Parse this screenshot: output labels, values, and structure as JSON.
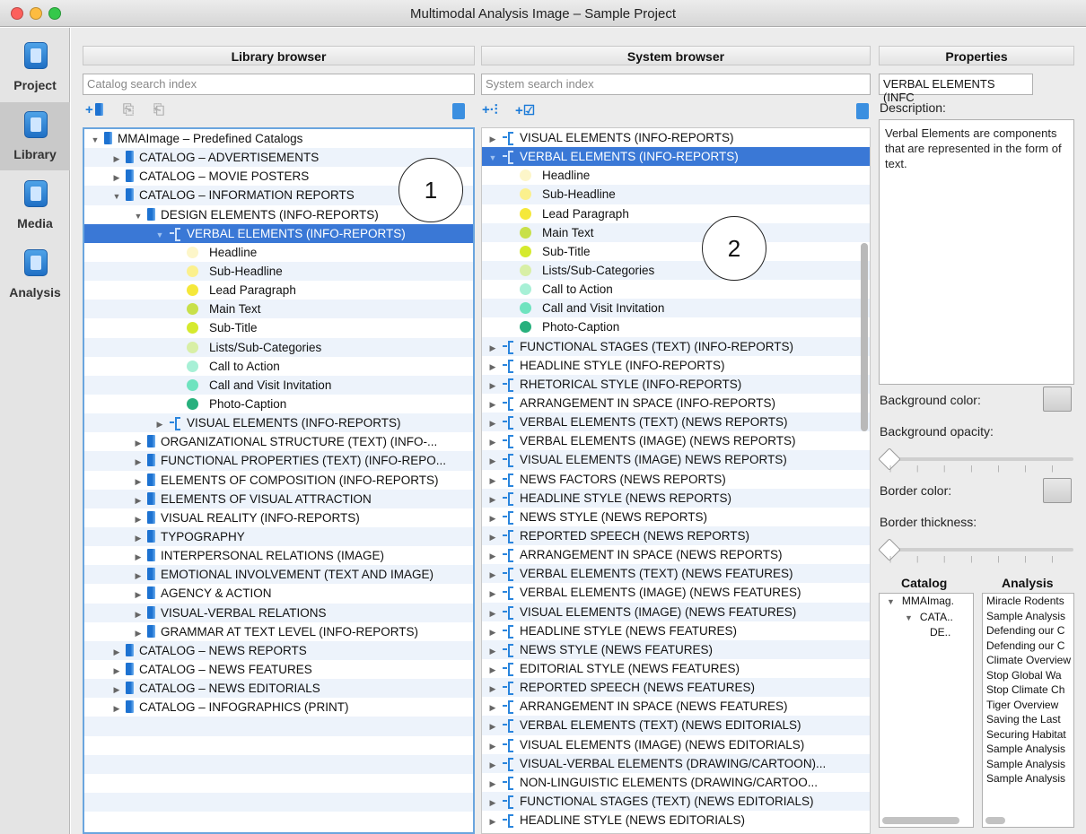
{
  "window": {
    "title": "Multimodal Analysis Image – Sample Project"
  },
  "nav": [
    {
      "label": "Project",
      "icon": "project-icon"
    },
    {
      "label": "Library",
      "icon": "library-icon"
    },
    {
      "label": "Media",
      "icon": "media-icon"
    },
    {
      "label": "Analysis",
      "icon": "analysis-icon"
    }
  ],
  "library": {
    "header": "Library browser",
    "search_placeholder": "Catalog search index",
    "tools": {
      "add": "+",
      "copy": "⎘",
      "paste": "⎗"
    },
    "callout": "1",
    "rows": [
      {
        "text": "MMAImage – Predefined Catalogs",
        "indent": 0,
        "tri": "▼",
        "icon": "book"
      },
      {
        "text": "CATALOG – ADVERTISEMENTS",
        "indent": 1,
        "tri": "▶",
        "icon": "book"
      },
      {
        "text": "CATALOG – MOVIE POSTERS",
        "indent": 1,
        "tri": "▶",
        "icon": "book"
      },
      {
        "text": "CATALOG – INFORMATION REPORTS",
        "indent": 1,
        "tri": "▼",
        "icon": "book"
      },
      {
        "text": "DESIGN ELEMENTS (INFO-REPORTS)",
        "indent": 2,
        "tri": "▼",
        "icon": "book"
      },
      {
        "text": "VERBAL ELEMENTS (INFO-REPORTS)",
        "indent": 3,
        "tri": "▼",
        "icon": "sys",
        "selected": true
      },
      {
        "text": "Headline",
        "indent": 4,
        "dot": "#fdf6c9"
      },
      {
        "text": "Sub-Headline",
        "indent": 4,
        "dot": "#fbf08d"
      },
      {
        "text": "Lead Paragraph",
        "indent": 4,
        "dot": "#f5e83a"
      },
      {
        "text": "Main Text",
        "indent": 4,
        "dot": "#c8e04a"
      },
      {
        "text": "Sub-Title",
        "indent": 4,
        "dot": "#d5ea2e"
      },
      {
        "text": "Lists/Sub-Categories",
        "indent": 4,
        "dot": "#d8efa6"
      },
      {
        "text": "Call to Action",
        "indent": 4,
        "dot": "#a7f0d6"
      },
      {
        "text": "Call and Visit Invitation",
        "indent": 4,
        "dot": "#6fe3bf"
      },
      {
        "text": "Photo-Caption",
        "indent": 4,
        "dot": "#27b07d"
      },
      {
        "text": "VISUAL ELEMENTS (INFO-REPORTS)",
        "indent": 3,
        "tri": "▶",
        "icon": "sys"
      },
      {
        "text": "ORGANIZATIONAL STRUCTURE (TEXT) (INFO-...",
        "indent": 2,
        "tri": "▶",
        "icon": "book"
      },
      {
        "text": "FUNCTIONAL PROPERTIES (TEXT) (INFO-REPO...",
        "indent": 2,
        "tri": "▶",
        "icon": "book"
      },
      {
        "text": "ELEMENTS OF COMPOSITION (INFO-REPORTS)",
        "indent": 2,
        "tri": "▶",
        "icon": "book"
      },
      {
        "text": "ELEMENTS OF VISUAL ATTRACTION",
        "indent": 2,
        "tri": "▶",
        "icon": "book"
      },
      {
        "text": "VISUAL REALITY (INFO-REPORTS)",
        "indent": 2,
        "tri": "▶",
        "icon": "book"
      },
      {
        "text": "TYPOGRAPHY",
        "indent": 2,
        "tri": "▶",
        "icon": "book"
      },
      {
        "text": "INTERPERSONAL RELATIONS (IMAGE)",
        "indent": 2,
        "tri": "▶",
        "icon": "book"
      },
      {
        "text": "EMOTIONAL INVOLVEMENT (TEXT AND IMAGE)",
        "indent": 2,
        "tri": "▶",
        "icon": "book"
      },
      {
        "text": "AGENCY & ACTION",
        "indent": 2,
        "tri": "▶",
        "icon": "book"
      },
      {
        "text": "VISUAL-VERBAL RELATIONS",
        "indent": 2,
        "tri": "▶",
        "icon": "book"
      },
      {
        "text": "GRAMMAR AT TEXT LEVEL (INFO-REPORTS)",
        "indent": 2,
        "tri": "▶",
        "icon": "book"
      },
      {
        "text": "CATALOG – NEWS REPORTS",
        "indent": 1,
        "tri": "▶",
        "icon": "book"
      },
      {
        "text": "CATALOG – NEWS FEATURES",
        "indent": 1,
        "tri": "▶",
        "icon": "book"
      },
      {
        "text": "CATALOG – NEWS EDITORIALS",
        "indent": 1,
        "tri": "▶",
        "icon": "book"
      },
      {
        "text": "CATALOG – INFOGRAPHICS (PRINT)",
        "indent": 1,
        "tri": "▶",
        "icon": "book"
      },
      {
        "text": "",
        "indent": 0
      },
      {
        "text": "",
        "indent": 0
      },
      {
        "text": "",
        "indent": 0
      },
      {
        "text": "",
        "indent": 0
      },
      {
        "text": "",
        "indent": 0
      }
    ]
  },
  "system": {
    "header": "System browser",
    "search_placeholder": "System search index",
    "tools": {
      "add_system": "+·⫶",
      "add_check": "+☑"
    },
    "callout": "2",
    "rows": [
      {
        "text": "VISUAL ELEMENTS (INFO-REPORTS)",
        "indent": 0,
        "tri": "▶",
        "icon": "sys"
      },
      {
        "text": "VERBAL ELEMENTS (INFO-REPORTS)",
        "indent": 0,
        "tri": "▼",
        "icon": "sys",
        "selected": true
      },
      {
        "text": "Headline",
        "indent": 1,
        "dot": "#fdf6c9"
      },
      {
        "text": "Sub-Headline",
        "indent": 1,
        "dot": "#fbf08d"
      },
      {
        "text": "Lead Paragraph",
        "indent": 1,
        "dot": "#f5e83a"
      },
      {
        "text": "Main Text",
        "indent": 1,
        "dot": "#c8e04a"
      },
      {
        "text": "Sub-Title",
        "indent": 1,
        "dot": "#d5ea2e"
      },
      {
        "text": "Lists/Sub-Categories",
        "indent": 1,
        "dot": "#d8efa6"
      },
      {
        "text": "Call to Action",
        "indent": 1,
        "dot": "#a7f0d6"
      },
      {
        "text": "Call and Visit Invitation",
        "indent": 1,
        "dot": "#6fe3bf"
      },
      {
        "text": "Photo-Caption",
        "indent": 1,
        "dot": "#27b07d"
      },
      {
        "text": "FUNCTIONAL STAGES (TEXT) (INFO-REPORTS)",
        "indent": 0,
        "tri": "▶",
        "icon": "sys"
      },
      {
        "text": "HEADLINE STYLE (INFO-REPORTS)",
        "indent": 0,
        "tri": "▶",
        "icon": "sys"
      },
      {
        "text": "RHETORICAL STYLE (INFO-REPORTS)",
        "indent": 0,
        "tri": "▶",
        "icon": "sys"
      },
      {
        "text": "ARRANGEMENT IN SPACE (INFO-REPORTS)",
        "indent": 0,
        "tri": "▶",
        "icon": "sys"
      },
      {
        "text": "VERBAL ELEMENTS (TEXT) (NEWS REPORTS)",
        "indent": 0,
        "tri": "▶",
        "icon": "sys"
      },
      {
        "text": "VERBAL ELEMENTS (IMAGE) (NEWS REPORTS)",
        "indent": 0,
        "tri": "▶",
        "icon": "sys"
      },
      {
        "text": "VISUAL ELEMENTS (IMAGE) NEWS REPORTS)",
        "indent": 0,
        "tri": "▶",
        "icon": "sys"
      },
      {
        "text": "NEWS FACTORS (NEWS REPORTS)",
        "indent": 0,
        "tri": "▶",
        "icon": "sys"
      },
      {
        "text": "HEADLINE STYLE (NEWS REPORTS)",
        "indent": 0,
        "tri": "▶",
        "icon": "sys"
      },
      {
        "text": "NEWS STYLE (NEWS REPORTS)",
        "indent": 0,
        "tri": "▶",
        "icon": "sys"
      },
      {
        "text": "REPORTED SPEECH (NEWS REPORTS)",
        "indent": 0,
        "tri": "▶",
        "icon": "sys"
      },
      {
        "text": "ARRANGEMENT IN SPACE (NEWS REPORTS)",
        "indent": 0,
        "tri": "▶",
        "icon": "sys"
      },
      {
        "text": "VERBAL ELEMENTS (TEXT) (NEWS FEATURES)",
        "indent": 0,
        "tri": "▶",
        "icon": "sys"
      },
      {
        "text": "VERBAL ELEMENTS (IMAGE) (NEWS FEATURES)",
        "indent": 0,
        "tri": "▶",
        "icon": "sys"
      },
      {
        "text": "VISUAL ELEMENTS (IMAGE) (NEWS FEATURES)",
        "indent": 0,
        "tri": "▶",
        "icon": "sys"
      },
      {
        "text": "HEADLINE STYLE (NEWS FEATURES)",
        "indent": 0,
        "tri": "▶",
        "icon": "sys"
      },
      {
        "text": "NEWS STYLE (NEWS FEATURES)",
        "indent": 0,
        "tri": "▶",
        "icon": "sys"
      },
      {
        "text": "EDITORIAL STYLE (NEWS FEATURES)",
        "indent": 0,
        "tri": "▶",
        "icon": "sys"
      },
      {
        "text": "REPORTED SPEECH (NEWS FEATURES)",
        "indent": 0,
        "tri": "▶",
        "icon": "sys"
      },
      {
        "text": "ARRANGEMENT IN SPACE (NEWS FEATURES)",
        "indent": 0,
        "tri": "▶",
        "icon": "sys"
      },
      {
        "text": "VERBAL ELEMENTS (TEXT) (NEWS EDITORIALS)",
        "indent": 0,
        "tri": "▶",
        "icon": "sys"
      },
      {
        "text": "VISUAL ELEMENTS (IMAGE) (NEWS EDITORIALS)",
        "indent": 0,
        "tri": "▶",
        "icon": "sys"
      },
      {
        "text": "VISUAL-VERBAL ELEMENTS (DRAWING/CARTOON)...",
        "indent": 0,
        "tri": "▶",
        "icon": "sys"
      },
      {
        "text": "NON-LINGUISTIC ELEMENTS (DRAWING/CARTOO...",
        "indent": 0,
        "tri": "▶",
        "icon": "sys"
      },
      {
        "text": "FUNCTIONAL STAGES (TEXT) (NEWS EDITORIALS)",
        "indent": 0,
        "tri": "▶",
        "icon": "sys"
      },
      {
        "text": "HEADLINE STYLE (NEWS EDITORIALS)",
        "indent": 0,
        "tri": "▶",
        "icon": "sys"
      }
    ]
  },
  "properties": {
    "header": "Properties",
    "name_value": "VERBAL ELEMENTS (INFC",
    "description_label": "Description:",
    "description_text": "Verbal Elements are components that are represented in the form of text.",
    "background_color_label": "Background color:",
    "background_opacity_label": "Background opacity:",
    "border_color_label": "Border color:",
    "border_thickness_label": "Border thickness:",
    "catalog_header": "Catalog",
    "analysis_header": "Analysis",
    "catalog_rows": [
      {
        "tri": "▼",
        "text": "MMAImag.",
        "indent": 0
      },
      {
        "tri": "▼",
        "text": "CATA..",
        "indent": 1
      },
      {
        "tri": "",
        "text": "DE..",
        "indent": 2
      }
    ],
    "analysis_rows": [
      "Miracle Rodents",
      "Sample Analysis",
      "Defending our C",
      "Defending our C",
      "Climate Overview",
      "Stop Global Wa",
      "Stop Climate Ch",
      "Tiger Overview",
      "Saving the Last",
      "Securing Habitat",
      "Sample Analysis",
      "Sample Analysis",
      "Sample Analysis"
    ]
  }
}
